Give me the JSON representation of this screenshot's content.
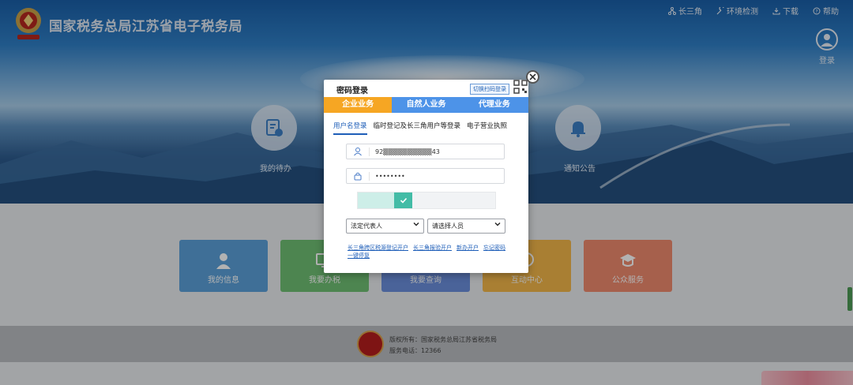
{
  "header": {
    "site_title": "国家税务总局江苏省电子税务局",
    "nav": [
      {
        "label": "长三角",
        "icon": "network-icon"
      },
      {
        "label": "环境检测",
        "icon": "tools-icon"
      },
      {
        "label": "下载",
        "icon": "download-icon"
      },
      {
        "label": "帮助",
        "icon": "help-icon"
      }
    ],
    "login_label": "登录"
  },
  "hero": {
    "left_label": "我的待办",
    "right_label": "通知公告"
  },
  "tiles": [
    {
      "label": "我的信息",
      "color": "#5b9fd8"
    },
    {
      "label": "我要办税",
      "color": "#6fbf73"
    },
    {
      "label": "我要查询",
      "color": "#6a8fdc"
    },
    {
      "label": "互动中心",
      "color": "#f2b74a"
    },
    {
      "label": "公众服务",
      "color": "#ee8a6e"
    }
  ],
  "footer": {
    "copyright": "版权所有：国家税务总局江苏省税务局",
    "phone": "服务电话：12366"
  },
  "modal": {
    "title": "密码登录",
    "qr_switch": "切换扫码登录",
    "type_tabs": [
      "企业业务",
      "自然人业务",
      "代理业务"
    ],
    "sub_tabs": [
      "用户名登录",
      "临时登记及长三角用户等登录",
      "电子营业执照"
    ],
    "username_value": "92▒▒▒▒▒▒▒▒▒▒43",
    "password_value": "••••••••",
    "role_select": "法定代表人",
    "person_select": "请选择人员",
    "links": [
      "长三角跨区税源登记开户",
      "长三角报验开户",
      "新办开户",
      "忘记密码",
      "一键停复"
    ]
  },
  "colors": {
    "accent_orange": "#f6a623",
    "accent_blue": "#4d93e8",
    "slider_green": "#42bca6"
  }
}
